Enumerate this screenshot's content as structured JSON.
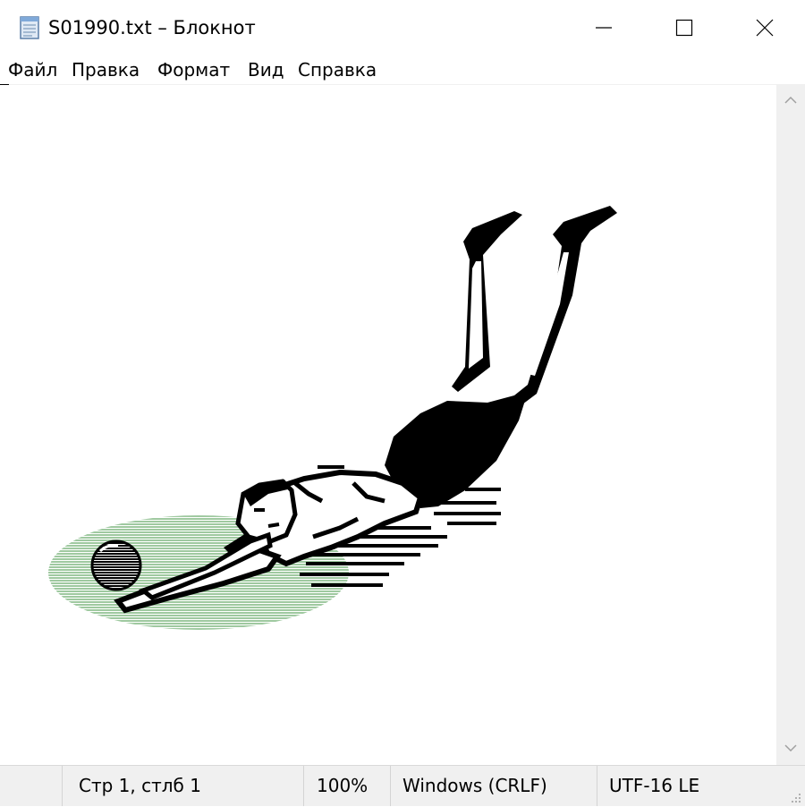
{
  "window": {
    "title": "S01990.txt – Блокнот",
    "controls": {
      "minimize": "minimize",
      "maximize": "maximize",
      "close": "close"
    }
  },
  "menu": {
    "items": [
      {
        "label": "Файл"
      },
      {
        "label": "Правка"
      },
      {
        "label": "Формат"
      },
      {
        "label": "Вид"
      },
      {
        "label": "Справка"
      }
    ]
  },
  "editor": {
    "content": "ASCII art: diving volleyball player reaching for a ball over a green oval shadow",
    "colors": {
      "ink": "#000000",
      "shadow": "#9fc9a0",
      "background": "#ffffff"
    }
  },
  "status": {
    "position": "Стр 1, стлб 1",
    "zoom": "100%",
    "line_endings": "Windows (CRLF)",
    "encoding": "UTF-16 LE"
  },
  "icons": {
    "app": "notepad-icon",
    "scroll_up": "chevron-up-icon",
    "scroll_down": "chevron-down-icon",
    "grip": "resize-grip-icon"
  }
}
